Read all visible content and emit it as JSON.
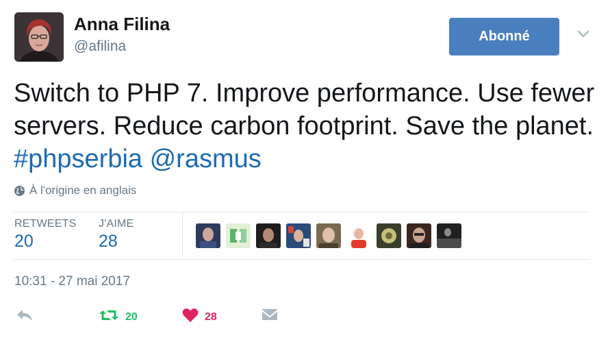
{
  "author": {
    "display_name": "Anna Filina",
    "screen_name": "@afilina"
  },
  "follow_button": {
    "label": "Abonné"
  },
  "tweet": {
    "text_plain": "Switch to PHP 7. Improve performance. Use fewer servers. Reduce carbon footprint. Save the planet.",
    "hashtag": "#phpserbia",
    "mention": "@rasmus",
    "translation_note": "À l'origine en anglais"
  },
  "stats": {
    "retweets_label": "RETWEETS",
    "retweets_count": "20",
    "likes_label": "J'AIME",
    "likes_count": "28"
  },
  "likers": [
    {
      "name": "liker-1",
      "colors": [
        "#2e3a5c",
        "#c8a99a"
      ]
    },
    {
      "name": "liker-2",
      "colors": [
        "#58b56b",
        "#d8e6c8"
      ]
    },
    {
      "name": "liker-3",
      "colors": [
        "#1d1d1d",
        "#b58a73"
      ]
    },
    {
      "name": "liker-4",
      "colors": [
        "#2a4a7a",
        "#d3473c"
      ]
    },
    {
      "name": "liker-5",
      "colors": [
        "#7a6a52",
        "#e0c0a8"
      ]
    },
    {
      "name": "liker-6",
      "colors": [
        "#ffffff",
        "#e03b2c"
      ]
    },
    {
      "name": "liker-7",
      "colors": [
        "#3a3f2c",
        "#c4c27a"
      ]
    },
    {
      "name": "liker-8",
      "colors": [
        "#3a2520",
        "#c9a58e"
      ]
    },
    {
      "name": "liker-9",
      "colors": [
        "#202020",
        "#8a8a8a"
      ]
    }
  ],
  "timestamp": "10:31 - 27 mai 2017",
  "actions": {
    "retweet_count": "20",
    "like_count": "28"
  },
  "colors": {
    "accent": "#1b6bb4",
    "follow_button": "#4a7fbf",
    "retweet": "#17bf63",
    "like": "#e0245e",
    "muted": "#657786"
  },
  "icons": {
    "reply": "reply-icon",
    "retweet": "retweet-icon",
    "like": "heart-icon",
    "dm": "envelope-icon",
    "caret": "chevron-down-icon",
    "globe": "globe-icon"
  }
}
